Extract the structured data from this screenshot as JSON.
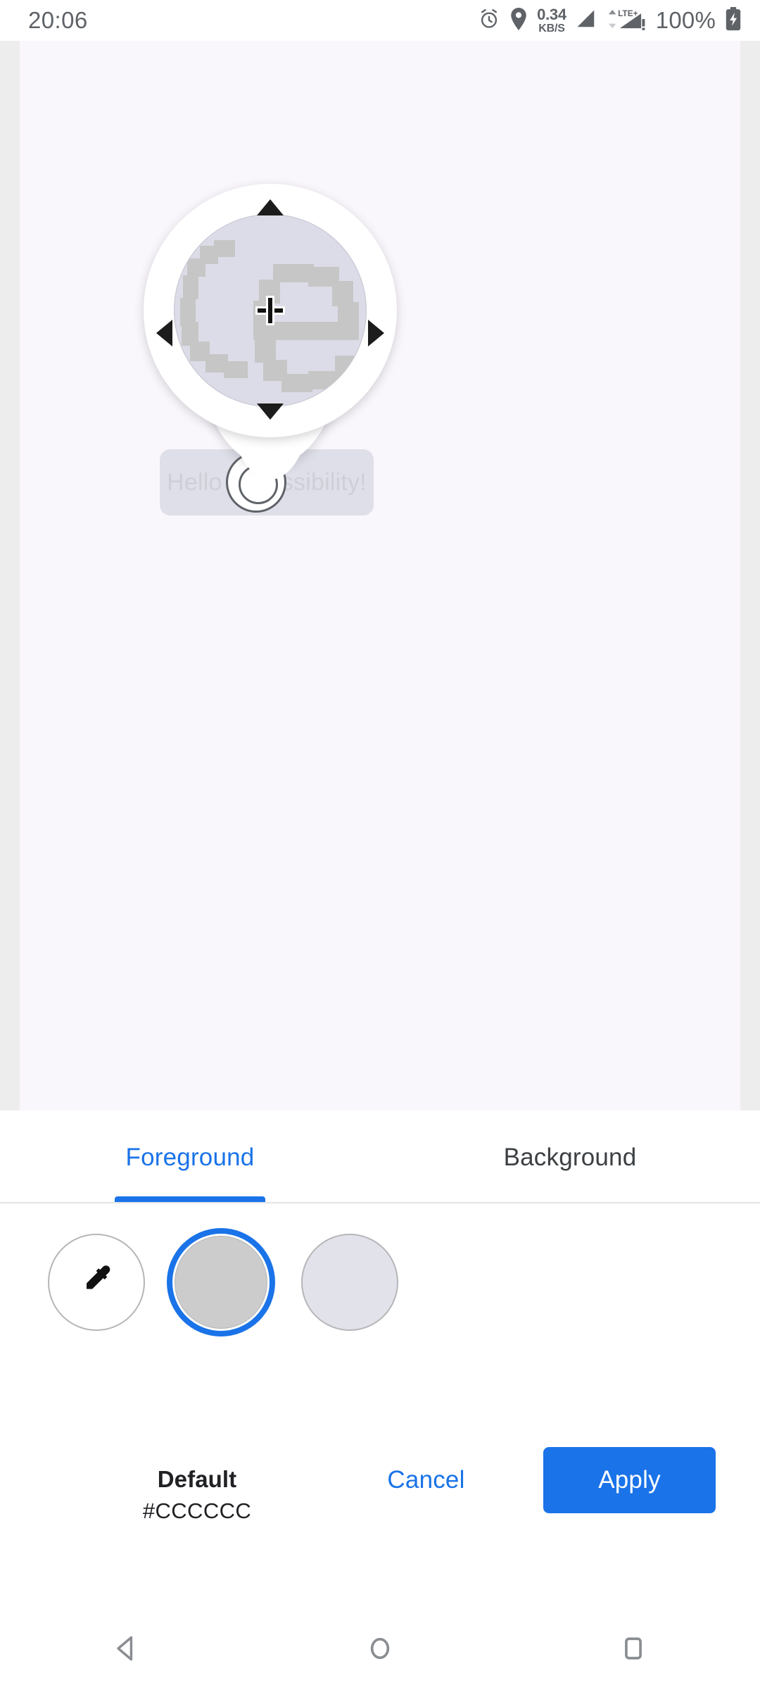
{
  "status_bar": {
    "time": "20:06",
    "alarm_icon": "alarm-icon",
    "location_icon": "location-pin-icon",
    "data_rate_value": "0.34",
    "data_rate_unit": "KB/S",
    "signal_icon": "signal-bars-icon",
    "network_type": "LTE+",
    "network_warning": "!",
    "battery_percent": "100%",
    "battery_icon": "battery-charging-icon"
  },
  "preview": {
    "sample_text": "Hello Accessibility!",
    "sample_chip_color": "#DFDFE9",
    "background_color": "#FAF7FC",
    "side_strip_color": "#EDEDED",
    "magnifier": {
      "name": "color-picker-loupe",
      "magnified_text": "ce",
      "magnified_background": "#DCDCE8",
      "magnified_glyph_color": "#C6C6C6",
      "crosshair": "+",
      "arrow_up": "▲",
      "arrow_down": "▼",
      "arrow_left": "◀",
      "arrow_right": "▶"
    },
    "touch_indicator": "touch-ring-indicator"
  },
  "sheet": {
    "tabs": [
      {
        "label": "Foreground",
        "active": true
      },
      {
        "label": "Background",
        "active": false
      }
    ],
    "active_tab_color": "#1A73E8",
    "inactive_tab_color": "#3C4043",
    "swatches": [
      {
        "name": "eyedropper",
        "icon": "eyedropper-icon",
        "color": "#FFFFFF",
        "selected": false
      },
      {
        "name": "default",
        "color": "#CCCCCC",
        "selected": true
      },
      {
        "name": "alternate",
        "color": "#E2E2EA",
        "selected": false
      }
    ],
    "selected_swatch_name": "Default",
    "selected_swatch_hex": "#CCCCCC",
    "cancel_label": "Cancel",
    "apply_label": "Apply",
    "apply_bg_color": "#1A73E8"
  },
  "navigation_bar": {
    "back": "back-button",
    "home": "home-button",
    "recents": "recents-button"
  }
}
